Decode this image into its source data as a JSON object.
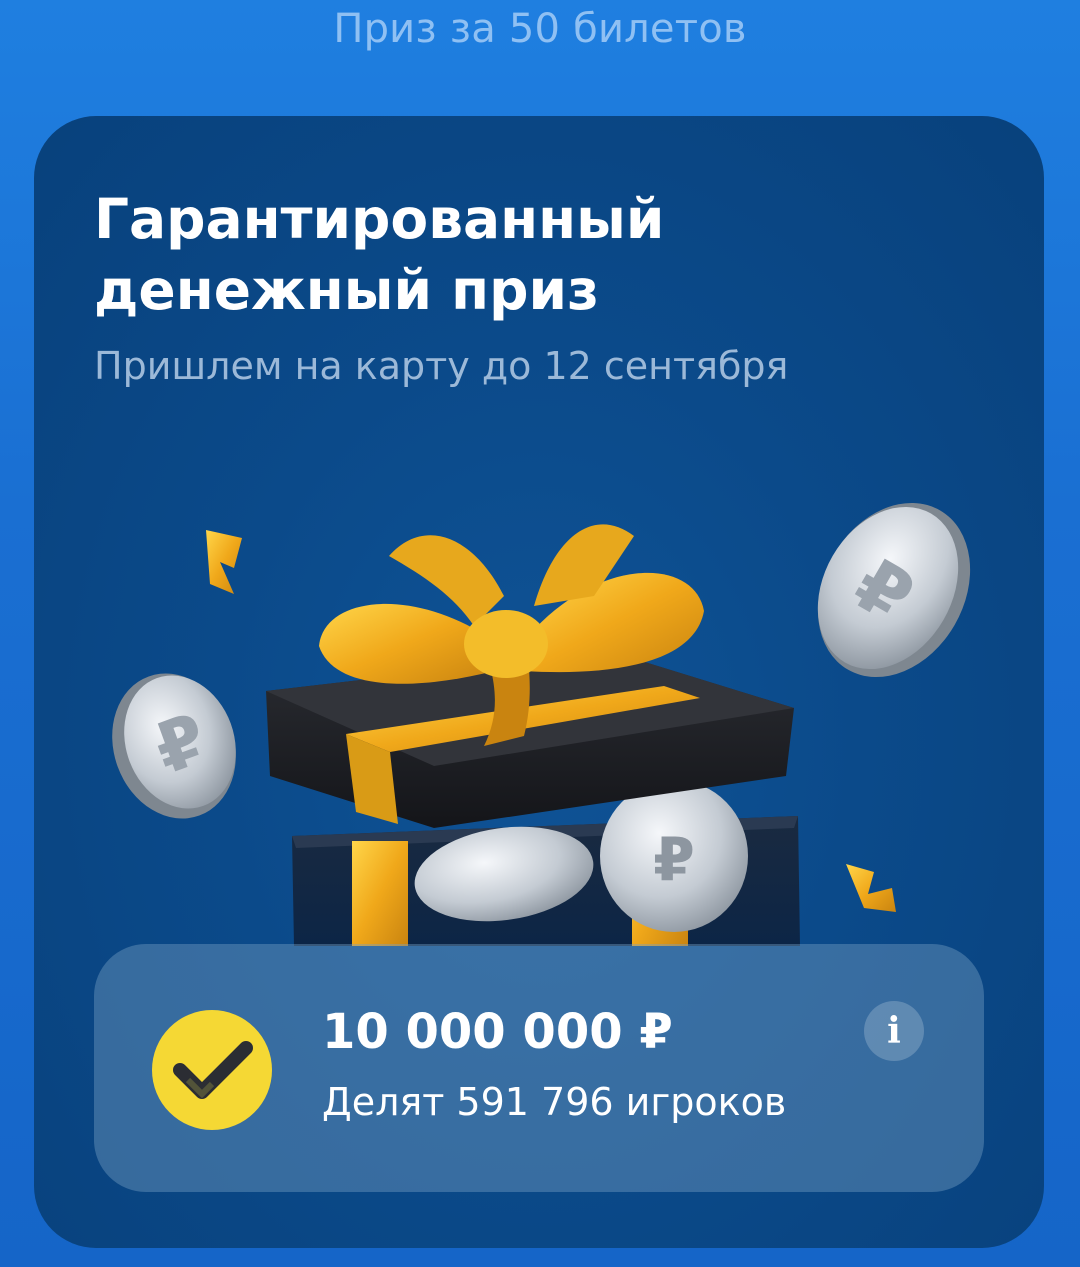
{
  "header": {
    "title": "Приз за 50 билетов"
  },
  "card": {
    "title_line1": "Гарантированный",
    "title_line2": "денежный приз",
    "subtitle": "Пришлем на карту до 12 сентября"
  },
  "prize": {
    "amount": "10 000 000 ₽",
    "players": "Делят 591 796 игроков",
    "info_icon": "info-icon",
    "badge_icon": "checkmark-icon"
  },
  "colors": {
    "background": "#1a6fd2",
    "card": "#0b4a8a",
    "badge": "#f5d834",
    "ribbon": "#f0b41c"
  }
}
